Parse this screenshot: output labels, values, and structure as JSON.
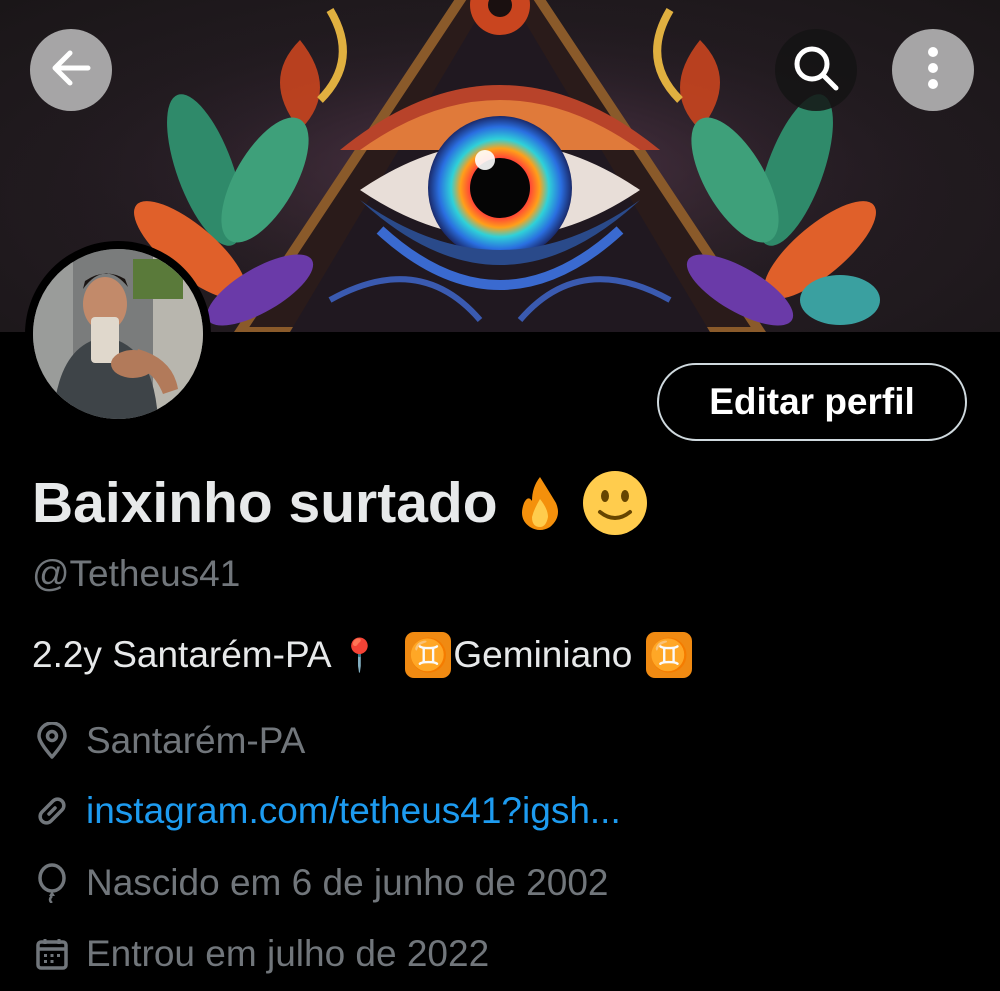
{
  "header": {
    "back_icon": "arrow-left-icon",
    "search_icon": "search-icon",
    "more_icon": "more-vertical-icon"
  },
  "profile": {
    "display_name": "Baixinho surtado",
    "name_emojis": "🔥 🙂",
    "handle": "@Tetheus41",
    "edit_button_label": "Editar perfil",
    "bio_part1": "2.2y Santarém-PA",
    "bio_pin": "📍",
    "bio_sign": "♊",
    "bio_part2": "Geminiano",
    "location": "Santarém-PA",
    "website": "instagram.com/tetheus41?igsh...",
    "birthday": "Nascido em 6 de junho de 2002",
    "joined": "Entrou em julho de 2022"
  },
  "colors": {
    "background": "#000000",
    "primary_text": "#e7e9ea",
    "secondary_text": "#71767b",
    "link": "#1d9bf0",
    "gemini_badge": "#f08a12"
  }
}
